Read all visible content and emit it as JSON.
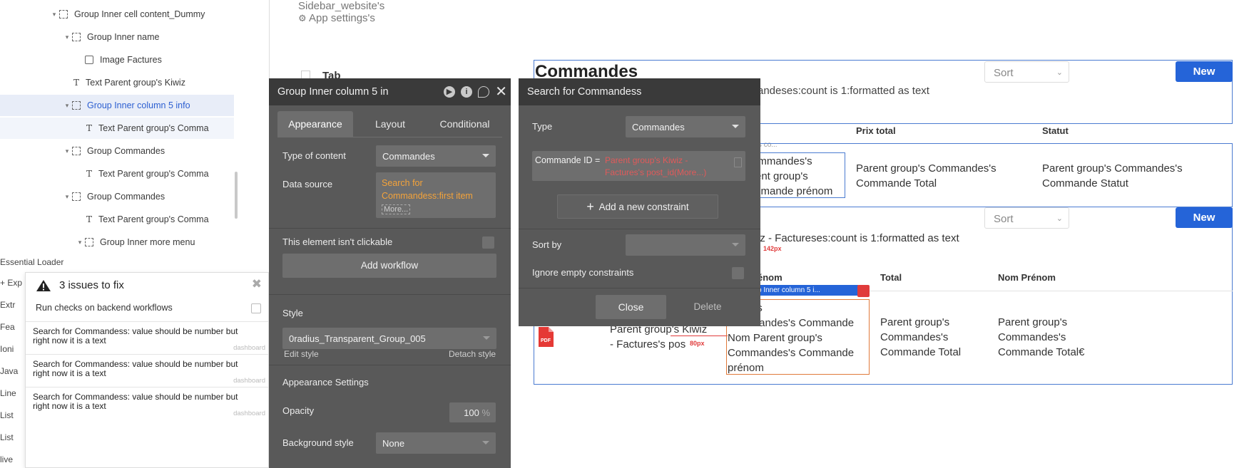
{
  "tree": {
    "items": [
      {
        "label": "Group Inner cell content_Dummy",
        "kind": "group",
        "indent": 0
      },
      {
        "label": "Group Inner name",
        "kind": "group",
        "indent": 1
      },
      {
        "label": "Image Factures",
        "kind": "image",
        "indent": 2
      },
      {
        "label": "Text Parent group's Kiwiz",
        "kind": "text",
        "indent": 1
      },
      {
        "label": "Group Inner column 5 info",
        "kind": "group",
        "indent": 1
      },
      {
        "label": "Text Parent group's Comma",
        "kind": "text",
        "indent": 2
      },
      {
        "label": "Group Commandes",
        "kind": "group",
        "indent": 1
      },
      {
        "label": "Text Parent group's Comma",
        "kind": "text",
        "indent": 2
      },
      {
        "label": "Group Commandes",
        "kind": "group",
        "indent": 1
      },
      {
        "label": "Text Parent group's Comma",
        "kind": "text",
        "indent": 2
      },
      {
        "label": "Group Inner more menu",
        "kind": "group",
        "indent": 2
      }
    ],
    "bottom_items": [
      "Essential Loader",
      "+ Exp",
      "Extr",
      "Fea",
      "Ioni",
      "Java",
      "Line",
      "List",
      "List",
      "live"
    ]
  },
  "issues": {
    "title": "3 issues to fix",
    "backend_label": "Run checks on backend workflows",
    "list": [
      {
        "text": "Search for Commandess: value should be number but right now it is a text",
        "link": "dashboard"
      },
      {
        "text": "Search for Commandess: value should be number but right now it is a text",
        "link": "dashboard"
      },
      {
        "text": "Search for Commandess: value should be number but right now it is a text",
        "link": "dashboard"
      }
    ]
  },
  "canvas": {
    "sidebar_text1": "Sidebar_website's",
    "sidebar_text2": "App settings's",
    "tab_text": "Tab",
    "commandes_title": "Commandes",
    "commandes_count": "andeses:count is 1:formatted as text",
    "sort_label": "Sort",
    "new_label": "New",
    "col_prix": "Prix total",
    "col_statut": "Statut",
    "row1_more": "'s co...",
    "row1_sel_text": "ommandes's\nrent group's\nmmande prénom",
    "row1_prix": "Parent group's Commandes's Commande Total",
    "row1_statut": "Parent group's Commandes's Commande Statut",
    "factures_count": "iz - Factureses:count is 1:formatted as text",
    "px142": "142px",
    "col_nom": "énom",
    "col_total": "Total",
    "col_nom_prenom": "Nom Prénom",
    "row2_tag": "p Inner column 5 i...",
    "row2_sel_text": "group's\nCommandes's Commande\nNom Parent group's\nCommandes's Commande\nprénom",
    "row2_kiwiz": "Parent group's Kiwiz\n- Factures's pos",
    "px80": "80px",
    "row2_total": "Parent group's\nCommandes's\nCommande Total",
    "row2_nomprenom": "Parent group's\nCommandes's\nCommande Total€",
    "pdf_label": "PDF"
  },
  "property_editor": {
    "title": "Group Inner column 5 in",
    "tabs": [
      "Appearance",
      "Layout",
      "Conditional"
    ],
    "type_label": "Type of content",
    "type_value": "Commandes",
    "datasource_label": "Data source",
    "datasource_value": "Search for Commandess:first item",
    "datasource_more": "More...",
    "clickable_label": "This element isn't clickable",
    "add_workflow": "Add workflow",
    "style_label": "Style",
    "style_value": "0radius_Transparent_Group_005",
    "edit_style": "Edit style",
    "detach_style": "Detach style",
    "appearance_settings": "Appearance Settings",
    "opacity_label": "Opacity",
    "opacity_value": "100",
    "opacity_unit": "%",
    "bgstyle_label": "Background style",
    "bgstyle_value": "None"
  },
  "search_dialog": {
    "title": "Search for Commandess",
    "type_label": "Type",
    "type_value": "Commandes",
    "constraint_key": "Commande ID =",
    "constraint_value": "Parent group's Kiwiz - Factures's post_id",
    "constraint_more": "(More...)",
    "add_constraint": "Add a new constraint",
    "sortby_label": "Sort by",
    "ignore_label": "Ignore empty constraints",
    "close_btn": "Close",
    "delete_btn": "Delete"
  },
  "colors": {
    "accent": "#2564d8",
    "panel": "#595959",
    "panel_header": "#3a3a3a",
    "error": "#e05a5a",
    "datasource": "#f4a33a"
  }
}
